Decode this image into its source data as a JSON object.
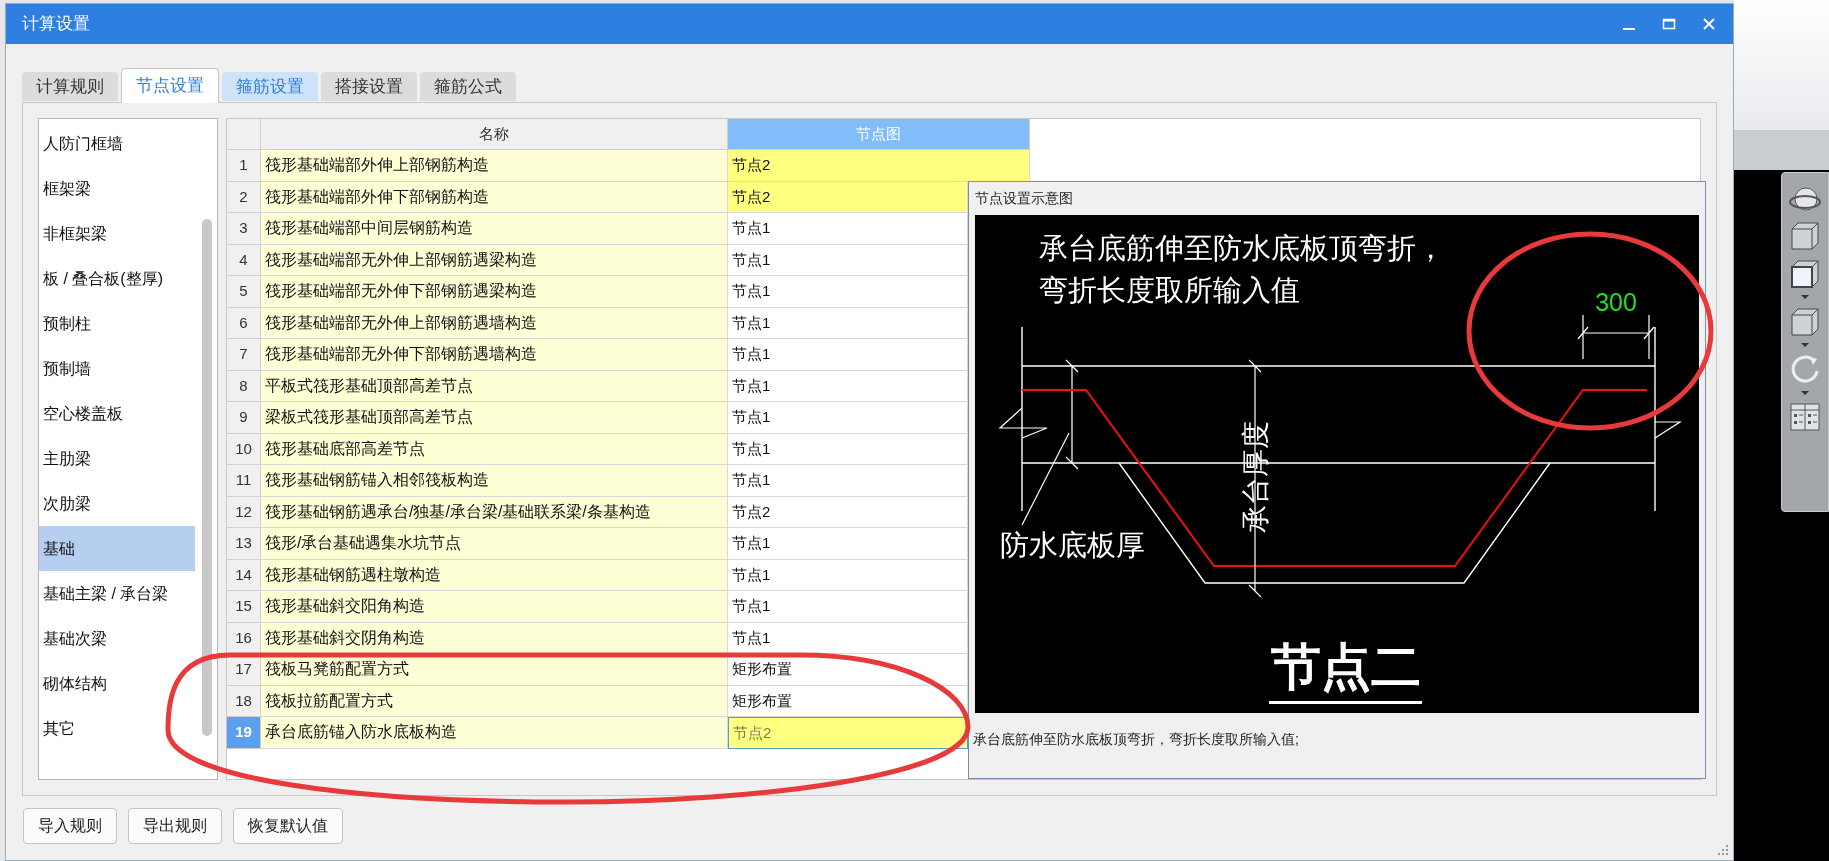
{
  "window": {
    "title": "计算设置"
  },
  "tabs": [
    {
      "label": "计算规则",
      "selected": false,
      "hovered": false
    },
    {
      "label": "节点设置",
      "selected": true,
      "hovered": false
    },
    {
      "label": "箍筋设置",
      "selected": false,
      "hovered": true
    },
    {
      "label": "搭接设置",
      "selected": false,
      "hovered": false
    },
    {
      "label": "箍筋公式",
      "selected": false,
      "hovered": false
    }
  ],
  "sidebar": {
    "items": [
      {
        "label": "人防门框墙",
        "selected": false
      },
      {
        "label": "框架梁",
        "selected": false
      },
      {
        "label": "非框架梁",
        "selected": false
      },
      {
        "label": "板 / 叠合板(整厚)",
        "selected": false
      },
      {
        "label": "预制柱",
        "selected": false
      },
      {
        "label": "预制墙",
        "selected": false
      },
      {
        "label": "空心楼盖板",
        "selected": false
      },
      {
        "label": "主肋梁",
        "selected": false
      },
      {
        "label": "次肋梁",
        "selected": false
      },
      {
        "label": "基础",
        "selected": true
      },
      {
        "label": "基础主梁 / 承台梁",
        "selected": false
      },
      {
        "label": "基础次梁",
        "selected": false
      },
      {
        "label": "砌体结构",
        "selected": false
      },
      {
        "label": "其它",
        "selected": false
      }
    ]
  },
  "table": {
    "columns": [
      "名称",
      "节点图"
    ],
    "rows": [
      {
        "index": "1",
        "name": "筏形基础端部外伸上部钢筋构造",
        "value": "节点2",
        "highlighted": true,
        "selected": false
      },
      {
        "index": "2",
        "name": "筏形基础端部外伸下部钢筋构造",
        "value": "节点2",
        "highlighted": true,
        "selected": false
      },
      {
        "index": "3",
        "name": "筏形基础端部中间层钢筋构造",
        "value": "节点1",
        "highlighted": false,
        "selected": false
      },
      {
        "index": "4",
        "name": "筏形基础端部无外伸上部钢筋遇梁构造",
        "value": "节点1",
        "highlighted": false,
        "selected": false
      },
      {
        "index": "5",
        "name": "筏形基础端部无外伸下部钢筋遇梁构造",
        "value": "节点1",
        "highlighted": false,
        "selected": false
      },
      {
        "index": "6",
        "name": "筏形基础端部无外伸上部钢筋遇墙构造",
        "value": "节点1",
        "highlighted": false,
        "selected": false
      },
      {
        "index": "7",
        "name": "筏形基础端部无外伸下部钢筋遇墙构造",
        "value": "节点1",
        "highlighted": false,
        "selected": false
      },
      {
        "index": "8",
        "name": "平板式筏形基础顶部高差节点",
        "value": "节点1",
        "highlighted": false,
        "selected": false
      },
      {
        "index": "9",
        "name": "梁板式筏形基础顶部高差节点",
        "value": "节点1",
        "highlighted": false,
        "selected": false
      },
      {
        "index": "10",
        "name": "筏形基础底部高差节点",
        "value": "节点1",
        "highlighted": false,
        "selected": false
      },
      {
        "index": "11",
        "name": "筏形基础钢筋锚入相邻筏板构造",
        "value": "节点1",
        "highlighted": false,
        "selected": false
      },
      {
        "index": "12",
        "name": "筏形基础钢筋遇承台/独基/承台梁/基础联系梁/条基构造",
        "value": "节点2",
        "highlighted": false,
        "selected": false
      },
      {
        "index": "13",
        "name": "筏形/承台基础遇集水坑节点",
        "value": "节点1",
        "highlighted": false,
        "selected": false
      },
      {
        "index": "14",
        "name": "筏形基础钢筋遇柱墩构造",
        "value": "节点1",
        "highlighted": false,
        "selected": false
      },
      {
        "index": "15",
        "name": "筏形基础斜交阳角构造",
        "value": "节点1",
        "highlighted": false,
        "selected": false
      },
      {
        "index": "16",
        "name": "筏形基础斜交阴角构造",
        "value": "节点1",
        "highlighted": false,
        "selected": false
      },
      {
        "index": "17",
        "name": "筏板马凳筋配置方式",
        "value": "矩形布置",
        "highlighted": false,
        "selected": false
      },
      {
        "index": "18",
        "name": "筏板拉筋配置方式",
        "value": "矩形布置",
        "highlighted": false,
        "selected": false
      },
      {
        "index": "19",
        "name": "承台底筋锚入防水底板构造",
        "value": "节点2",
        "highlighted": true,
        "selected": true
      }
    ]
  },
  "preview": {
    "title": "节点设置示意图",
    "drawing": {
      "note_lines": [
        "承台底筋伸至防水底板顶弯折，",
        "弯折长度取所输入值"
      ],
      "dimension": "300",
      "depth_label": "承台厚度",
      "slab_label": "防水底板厚",
      "node_title": "节点二"
    },
    "caption": "承台底筋伸至防水底板顶弯折，弯折长度取所输入值;"
  },
  "buttons": [
    "导入规则",
    "导出规则",
    "恢复默认值"
  ],
  "annotations": [
    {
      "kind": "ellipse"
    },
    {
      "kind": "ellipse"
    }
  ]
}
